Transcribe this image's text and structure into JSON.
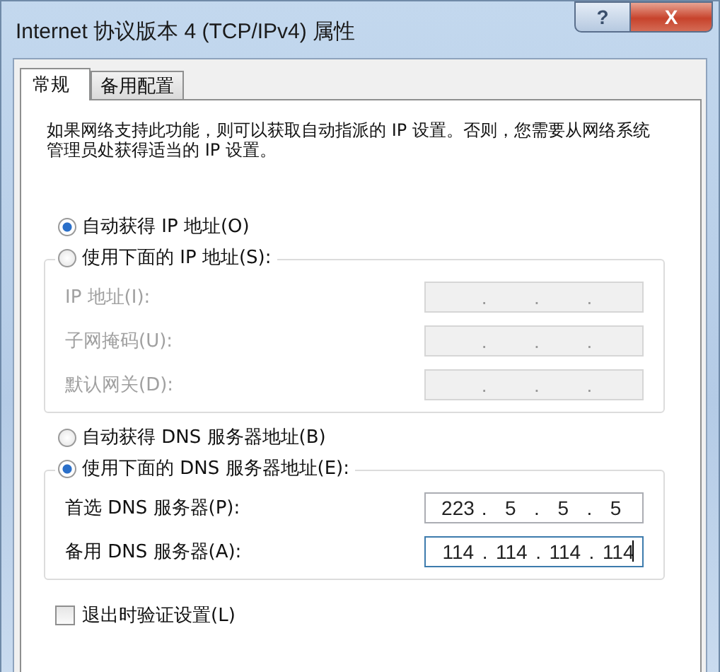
{
  "window": {
    "title": "Internet 协议版本 4 (TCP/IPv4) 属性",
    "buttons": [
      {
        "kind": "help",
        "label": "?"
      },
      {
        "kind": "close",
        "label": "X"
      }
    ]
  },
  "tabs": [
    {
      "label": "常规",
      "selected": true
    },
    {
      "label": "备用配置",
      "selected": false
    }
  ],
  "description": "如果网络支持此功能，则可以获取自动指派的 IP 设置。否则，您需要从网络系统管理员处获得适当的 IP 设置。",
  "octet_separator": ".",
  "sections": [
    {
      "options": [
        {
          "label": "自动获得 IP 地址(O)",
          "selected": true
        },
        {
          "label": "使用下面的 IP 地址(S):",
          "selected": false
        }
      ],
      "disabled": true,
      "fields": [
        {
          "label": "IP 地址(I):",
          "focused": false
        },
        {
          "label": "子网掩码(U):",
          "focused": false
        },
        {
          "label": "默认网关(D):",
          "focused": false
        }
      ]
    },
    {
      "options": [
        {
          "label": "自动获得 DNS 服务器地址(B)",
          "selected": false
        },
        {
          "label": "使用下面的 DNS 服务器地址(E):",
          "selected": true
        }
      ],
      "disabled": false,
      "fields": [
        {
          "label": "首选 DNS 服务器(P):",
          "octets": [
            "223",
            "5",
            "5",
            "5"
          ],
          "focused": false
        },
        {
          "label": "备用 DNS 服务器(A):",
          "octets": [
            "114",
            "114",
            "114",
            "114"
          ],
          "focused": true
        }
      ]
    }
  ],
  "validate_on_exit": {
    "label": "退出时验证设置(L)",
    "checked": false
  }
}
